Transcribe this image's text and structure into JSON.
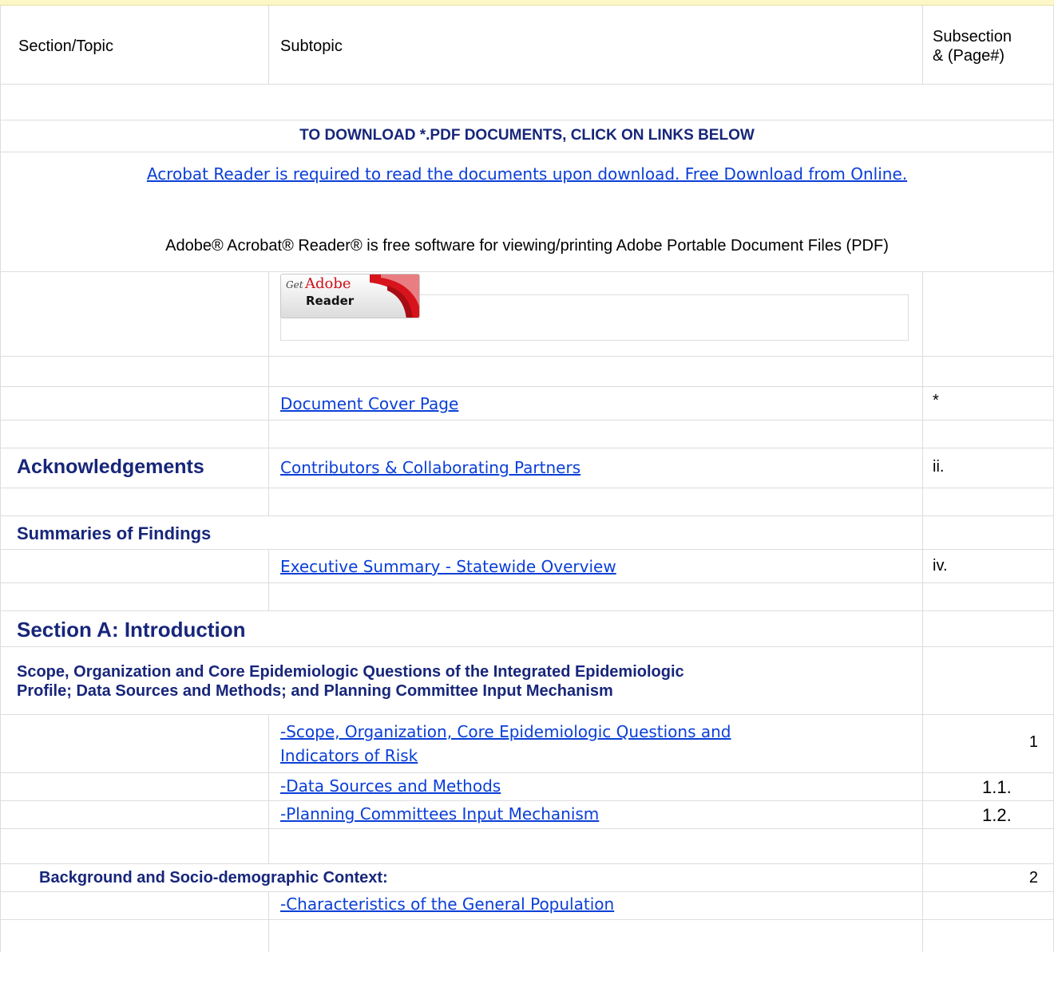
{
  "header": {
    "col1": "Section/Topic",
    "col2": "Subtopic",
    "col3_line1": "Subsection",
    "col3_line2": "& (Page#)"
  },
  "download": {
    "heading": "TO DOWNLOAD *.PDF DOCUMENTS, CLICK ON LINKS BELOW",
    "acrobat_link": "Acrobat Reader is required to read the documents upon download. Free Download from Online.",
    "adobe_note": "Adobe® Acrobat® Reader® is free software for viewing/printing Adobe Portable Document Files (PDF)",
    "badge_get": "Get",
    "badge_adobe": "Adobe",
    "badge_reader": "Reader"
  },
  "rows": {
    "cover": {
      "link": "Document Cover Page",
      "page": "*"
    },
    "ack": {
      "section": "Acknowledgements",
      "link": "Contributors & Collaborating Partners",
      "page": "ii."
    },
    "summaries": {
      "section": "Summaries of Findings"
    },
    "exec": {
      "link": "Executive Summary - Statewide Overview",
      "page": "iv."
    },
    "sectionA": {
      "section": "Section A: Introduction"
    },
    "scope_heading": {
      "line1": "Scope, Organization and Core Epidemiologic Questions of the Integrated Epidemiologic",
      "line2": "Profile; Data Sources and Methods; and Planning Committee Input Mechanism"
    },
    "scope": {
      "link_line1": "-Scope, Organization, Core Epidemiologic Questions and",
      "link_line2": "Indicators of Risk",
      "page": "1"
    },
    "data_sources": {
      "link": "-Data Sources and Methods",
      "page": "1.1."
    },
    "planning": {
      "link": "-Planning Committees Input Mechanism",
      "page": "1.2."
    },
    "background": {
      "section": "Background and Socio-demographic Context:",
      "page": "2"
    },
    "characteristics": {
      "link": "-Characteristics of the General Population"
    }
  }
}
